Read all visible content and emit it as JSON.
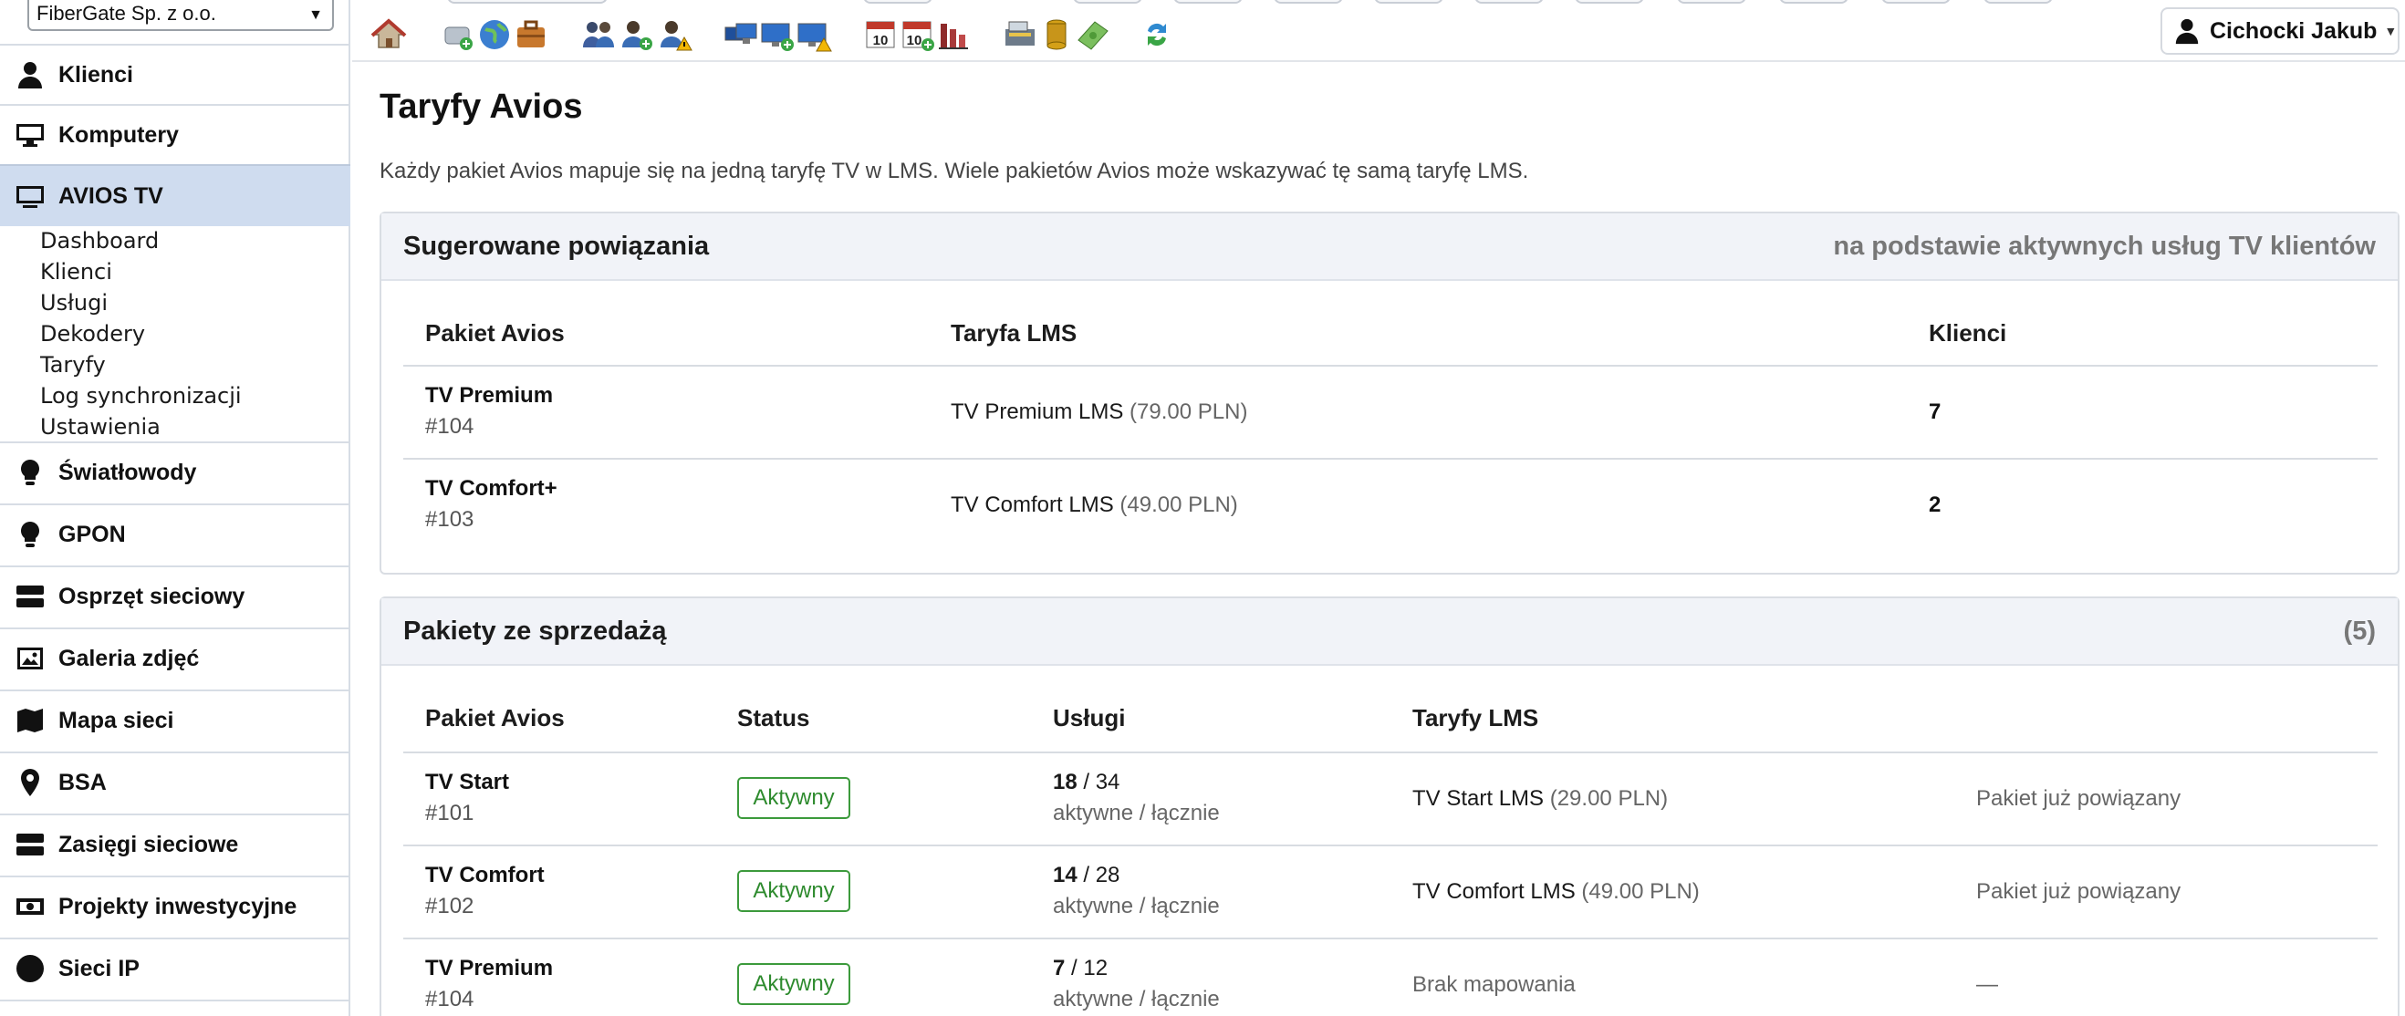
{
  "company": {
    "selected": "FiberGate Sp. z o.o."
  },
  "sidebar": {
    "items": [
      {
        "label": "Klienci",
        "icon": "user-icon"
      },
      {
        "label": "Komputery",
        "icon": "monitor-icon"
      },
      {
        "label": "AVIOS TV",
        "icon": "tv-icon",
        "active": true
      },
      {
        "label": "Światłowody",
        "icon": "lightbulb-icon"
      },
      {
        "label": "GPON",
        "icon": "lightbulb-icon"
      },
      {
        "label": "Osprzęt sieciowy",
        "icon": "server-icon"
      },
      {
        "label": "Galeria zdjęć",
        "icon": "image-icon"
      },
      {
        "label": "Mapa sieci",
        "icon": "map-icon"
      },
      {
        "label": "BSA",
        "icon": "map-pin-icon"
      },
      {
        "label": "Zasięgi sieciowe",
        "icon": "server-icon"
      },
      {
        "label": "Projekty inwestycyjne",
        "icon": "money-icon"
      },
      {
        "label": "Sieci IP",
        "icon": "globe-icon"
      }
    ],
    "subitems": [
      "Dashboard",
      "Klienci",
      "Usługi",
      "Dekodery",
      "Taryfy",
      "Log synchronizacji",
      "Ustawienia"
    ]
  },
  "user": {
    "name": "Cichocki Jakub"
  },
  "page": {
    "title": "Taryfy Avios",
    "description": "Każdy pakiet Avios mapuje się na jedną taryfę TV w LMS. Wiele pakietów Avios może wskazywać tę samą taryfę LMS."
  },
  "suggested": {
    "title": "Sugerowane powiązania",
    "meta": "na podstawie aktywnych usług TV klientów",
    "columns": [
      "Pakiet Avios",
      "Taryfa LMS",
      "Klienci"
    ],
    "rows": [
      {
        "name": "TV Premium",
        "id": "#104",
        "tariff": "TV Premium LMS",
        "price": "(79.00 PLN)",
        "clients": "7"
      },
      {
        "name": "TV Comfort+",
        "id": "#103",
        "tariff": "TV Comfort LMS",
        "price": "(49.00 PLN)",
        "clients": "2"
      }
    ]
  },
  "packages": {
    "title": "Pakiety ze sprzedażą",
    "count": "(5)",
    "columns": [
      "Pakiet Avios",
      "Status",
      "Usługi",
      "Taryfy LMS"
    ],
    "rows": [
      {
        "name": "TV Start",
        "id": "#101",
        "status": "Aktywny",
        "active": "18",
        "total": "/ 34",
        "caption": "aktywne / łącznie",
        "tariff": "TV Start LMS",
        "price": "(29.00 PLN)",
        "note": "Pakiet już powiązany"
      },
      {
        "name": "TV Comfort",
        "id": "#102",
        "status": "Aktywny",
        "active": "14",
        "total": "/ 28",
        "caption": "aktywne / łącznie",
        "tariff": "TV Comfort LMS",
        "price": "(49.00 PLN)",
        "note": "Pakiet już powiązany"
      },
      {
        "name": "TV Premium",
        "id": "#104",
        "status": "Aktywny",
        "active": "7",
        "total": "/ 12",
        "caption": "aktywne / łącznie",
        "tariff": "Brak mapowania",
        "price": "",
        "note": "—"
      }
    ]
  }
}
